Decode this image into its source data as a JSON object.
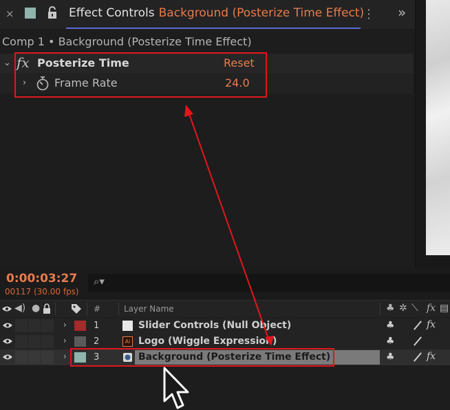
{
  "effect_controls": {
    "close_glyph": "×",
    "title_prefix": "Effect Controls",
    "title_layer": "Background (Posterize Time Effect)",
    "menu_glyph": "⋮",
    "expand_glyph": "»",
    "comp_path": "Comp 1 • Background (Posterize Time Effect)",
    "effect": {
      "fx_label": "fx",
      "name": "Posterize Time",
      "reset_label": "Reset",
      "property": {
        "name": "Frame Rate",
        "value": "24.0"
      }
    }
  },
  "timeline": {
    "timecode": "0:00:03:27",
    "frame_info": "00117 (30.00 fps)",
    "search_glyph": "⌕▾",
    "headers": {
      "number": "#",
      "layer_name": "Layer Name"
    },
    "layers": [
      {
        "number": "1",
        "name": "Slider Controls (Null Object)",
        "label_color": "#a52a2a",
        "source": "null-object-icon"
      },
      {
        "number": "2",
        "name": "Logo (Wiggle Expression)",
        "label_color": "#5a5a5a",
        "source": "illustrator-file-icon",
        "source_text": "Ai"
      },
      {
        "number": "3",
        "name": "Background (Posterize Time Effect)",
        "label_color": "#8fb4ae",
        "source": "image-file-icon",
        "selected": true
      }
    ],
    "switch_glyphs": {
      "shy": "♣",
      "fx": "fx"
    }
  },
  "colors": {
    "accent_orange": "#e87b4e",
    "highlight_red": "#e3161c",
    "tab_underline": "#5c6bd6"
  }
}
